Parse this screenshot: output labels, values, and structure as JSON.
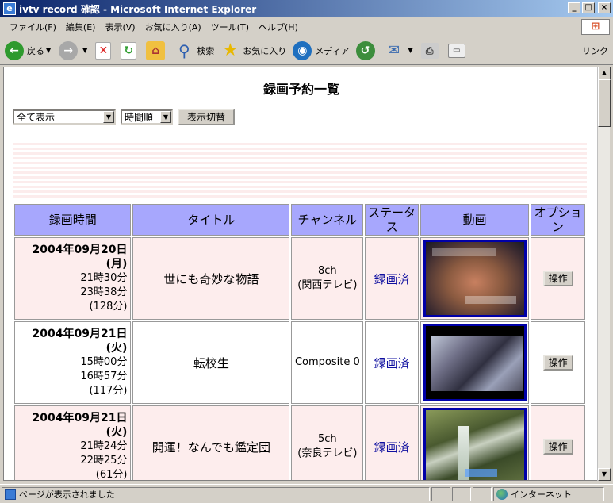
{
  "window": {
    "title": "ivtv record 確認 - Microsoft Internet Explorer",
    "controls": {
      "minimize": "_",
      "maximize": "□",
      "close": "×"
    }
  },
  "menu": [
    "ファイル(F)",
    "編集(E)",
    "表示(V)",
    "お気に入り(A)",
    "ツール(T)",
    "ヘルプ(H)"
  ],
  "toolbar": {
    "back": "戻る",
    "search": "検索",
    "favorites": "お気に入り",
    "media": "メディア",
    "links": "リンク"
  },
  "page": {
    "title": "録画予約一覧",
    "filter_select": "全て表示",
    "order_select": "時間順",
    "toggle_button": "表示切替"
  },
  "table": {
    "headers": [
      "録画時間",
      "タイトル",
      "チャンネル",
      "ステータス",
      "動画",
      "オプション"
    ],
    "rows": [
      {
        "date": "2004年09月20日",
        "weekday": "(月)",
        "start": "21時30分",
        "end": "23時38分",
        "duration": "(128分)",
        "title": "世にも奇妙な物語",
        "channel": "8ch",
        "channel_name": "(関西テレビ)",
        "status": "録画済",
        "action": "操作"
      },
      {
        "date": "2004年09月21日",
        "weekday": "(火)",
        "start": "15時00分",
        "end": "16時57分",
        "duration": "(117分)",
        "title": "転校生",
        "channel": "Composite 0",
        "channel_name": "",
        "status": "録画済",
        "action": "操作"
      },
      {
        "date": "2004年09月21日",
        "weekday": "(火)",
        "start": "21時24分",
        "end": "22時25分",
        "duration": "(61分)",
        "title": "開運！なんでも鑑定団",
        "channel": "5ch",
        "channel_name": "(奈良テレビ)",
        "status": "録画済",
        "action": "操作"
      }
    ]
  },
  "status_bar": {
    "message": "ページが表示されました",
    "zone": "インターネット"
  },
  "colors": {
    "header_bg": "#a7a7fd",
    "row_pink": "#fdeded",
    "status_link": "#1010a0",
    "thumb_border": "#0000a8"
  }
}
